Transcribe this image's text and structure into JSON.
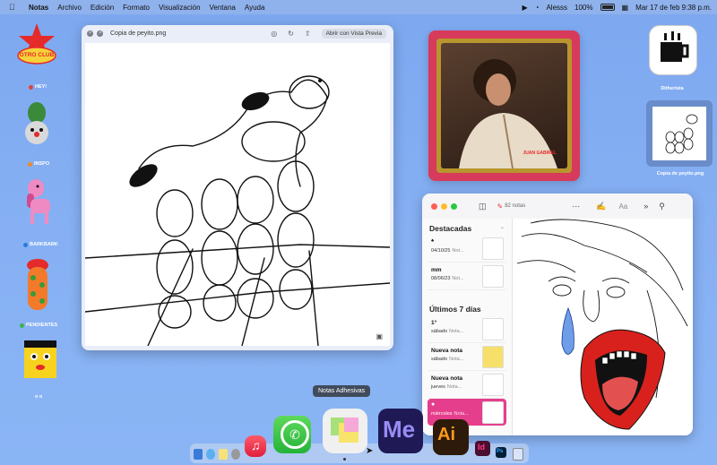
{
  "menubar": {
    "app": "Notas",
    "items": [
      "Archivo",
      "Edición",
      "Formato",
      "Visualización",
      "Ventana",
      "Ayuda"
    ],
    "user": "Alesss",
    "battery": "100%",
    "datetime": "Mar 17 de feb  9:38 p.m."
  },
  "desktop": {
    "club_label": "OTRO CLUB",
    "folders": [
      {
        "label": "HEY!",
        "color": "#e0433b"
      },
      {
        "label": "INSPO",
        "color": "#f08a2c"
      },
      {
        "label": "BARKBARK",
        "color": "#2a7ad8"
      },
      {
        "label": "PENDIENTES",
        "color": "#3bb34a"
      }
    ],
    "bottom_label": "o o",
    "dither_label": "Ditherista",
    "file_label": "Copia de peyito.png"
  },
  "quicklook": {
    "title": "Copia de peyito.png",
    "open_button": "Abrir con Vista Previa"
  },
  "album": {
    "caption": "JUAN GABRIEL"
  },
  "notes": {
    "count": "82 notas",
    "search_placeholder": "Aa",
    "sections": [
      {
        "title": "Destacadas",
        "rows": [
          {
            "title": "",
            "date": "04/10/25",
            "preview": "Not..."
          },
          {
            "title": "mm",
            "date": "08/06/23",
            "preview": "Not..."
          }
        ]
      },
      {
        "title": "Últimos 7 días",
        "rows": [
          {
            "title": "1°",
            "date": "sábado",
            "preview": "Nota..."
          },
          {
            "title": "Nueva nota",
            "date": "sábado",
            "preview": "Nota..."
          },
          {
            "title": "Nueva nota",
            "date": "jueves",
            "preview": "Nota..."
          },
          {
            "title": "",
            "date": "miércoles",
            "preview": "Nota..."
          }
        ]
      }
    ]
  },
  "dock": {
    "tooltip": "Notas Adhesivas",
    "apps": [
      "Música",
      "WhatsApp",
      "Notas Adhesivas",
      "Media Encoder",
      "Illustrator",
      "InDesign",
      "Photoshop",
      "Papelera"
    ]
  },
  "colors": {
    "accent_pink": "#e53e8c",
    "album_red": "#d73a5a",
    "desktop_blue": "#86b0f3"
  }
}
